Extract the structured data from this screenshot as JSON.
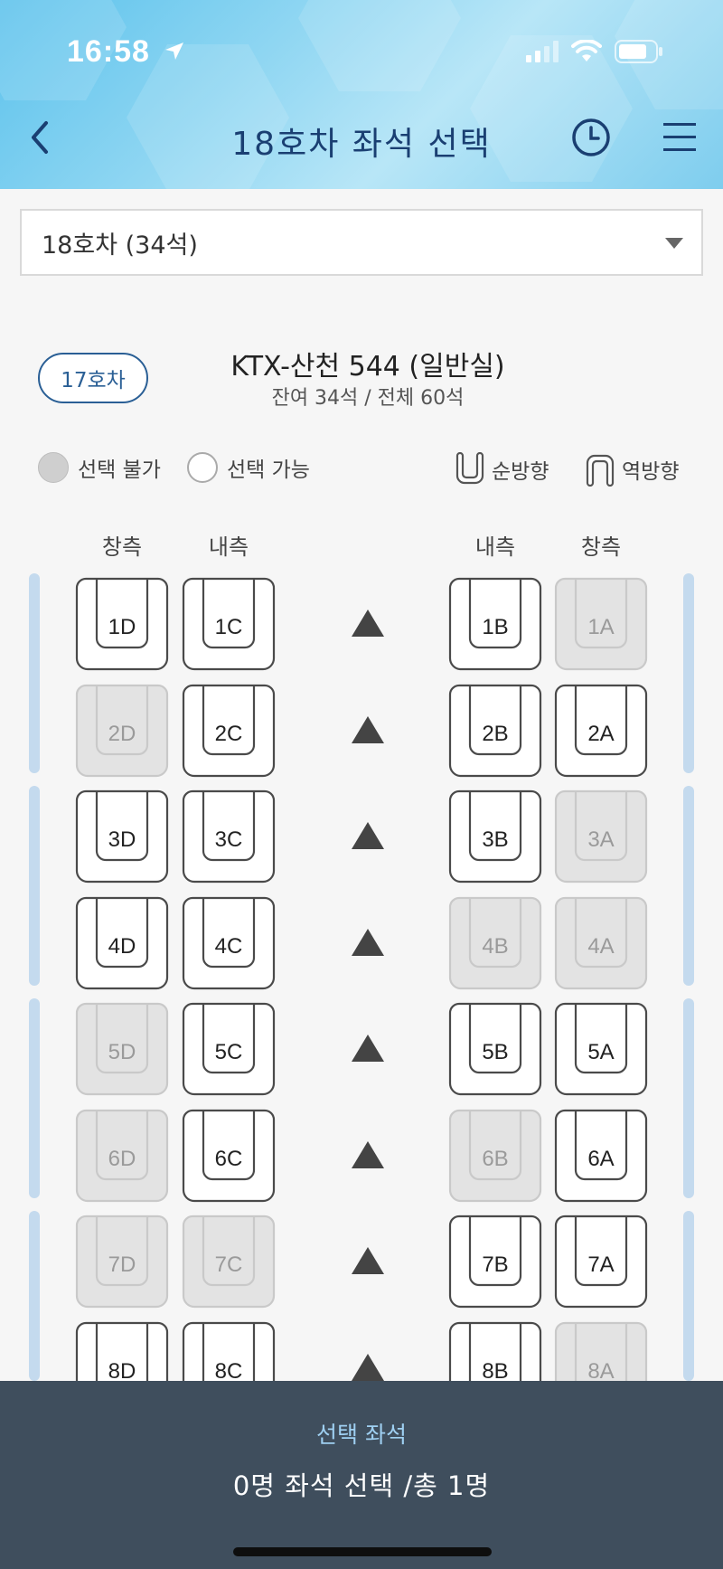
{
  "status_bar": {
    "time": "16:58"
  },
  "header": {
    "title": "18호차 좌석 선택",
    "back_icon": "chevron-left-icon",
    "history_icon": "clock-icon",
    "menu_icon": "hamburger-menu-icon"
  },
  "car_select": {
    "value": "18호차 (34석)"
  },
  "train_info": {
    "prev_car_button": "17호차",
    "name": "KTX-산천 544 (일반실)",
    "remaining": "잔여 34석 / 전체 60석"
  },
  "legend": {
    "unavailable": "선택 불가",
    "available": "선택 가능",
    "forward": "순방향",
    "reverse": "역방향"
  },
  "column_labels": {
    "left_window": "창측",
    "left_aisle": "내측",
    "right_aisle": "내측",
    "right_window": "창측"
  },
  "seats": [
    {
      "row": 1,
      "D": {
        "label": "1D",
        "available": true
      },
      "C": {
        "label": "1C",
        "available": true
      },
      "B": {
        "label": "1B",
        "available": true
      },
      "A": {
        "label": "1A",
        "available": false
      }
    },
    {
      "row": 2,
      "D": {
        "label": "2D",
        "available": false
      },
      "C": {
        "label": "2C",
        "available": true
      },
      "B": {
        "label": "2B",
        "available": true
      },
      "A": {
        "label": "2A",
        "available": true
      }
    },
    {
      "row": 3,
      "D": {
        "label": "3D",
        "available": true
      },
      "C": {
        "label": "3C",
        "available": true
      },
      "B": {
        "label": "3B",
        "available": true
      },
      "A": {
        "label": "3A",
        "available": false
      }
    },
    {
      "row": 4,
      "D": {
        "label": "4D",
        "available": true
      },
      "C": {
        "label": "4C",
        "available": true
      },
      "B": {
        "label": "4B",
        "available": false
      },
      "A": {
        "label": "4A",
        "available": false
      }
    },
    {
      "row": 5,
      "D": {
        "label": "5D",
        "available": false
      },
      "C": {
        "label": "5C",
        "available": true
      },
      "B": {
        "label": "5B",
        "available": true
      },
      "A": {
        "label": "5A",
        "available": true
      }
    },
    {
      "row": 6,
      "D": {
        "label": "6D",
        "available": false
      },
      "C": {
        "label": "6C",
        "available": true
      },
      "B": {
        "label": "6B",
        "available": false
      },
      "A": {
        "label": "6A",
        "available": true
      }
    },
    {
      "row": 7,
      "D": {
        "label": "7D",
        "available": false
      },
      "C": {
        "label": "7C",
        "available": false
      },
      "B": {
        "label": "7B",
        "available": true
      },
      "A": {
        "label": "7A",
        "available": true
      }
    },
    {
      "row": 8,
      "D": {
        "label": "8D",
        "available": true
      },
      "C": {
        "label": "8C",
        "available": true
      },
      "B": {
        "label": "8B",
        "available": true
      },
      "A": {
        "label": "8A",
        "available": false
      }
    }
  ],
  "seat_direction": "forward",
  "aisle_icon": "direction-up-arrow-icon",
  "bottom_bar": {
    "title": "선택 좌석",
    "summary": "0명 좌석 선택 /총 1명"
  },
  "colors": {
    "header_title": "#1a3f72",
    "accent": "#2a5f95",
    "bottom_bar": "#3f4e5d",
    "bottom_title": "#9fd0f2",
    "rail": "#c4daee"
  }
}
